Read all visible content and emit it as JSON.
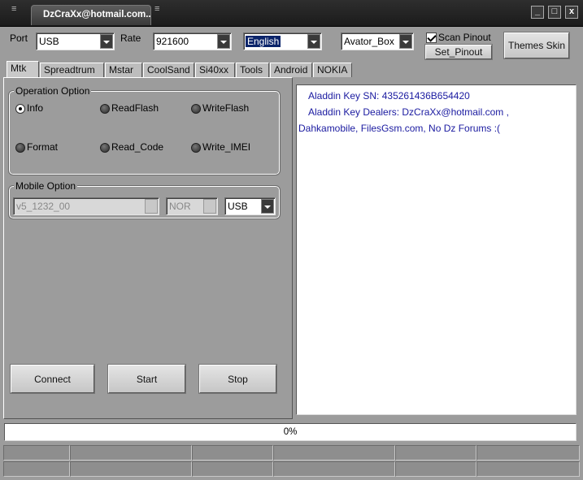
{
  "window": {
    "title": "DzCraXx@hotmail.com..",
    "minimize_label": "_",
    "maximize_label": "□",
    "close_label": "x"
  },
  "toolbar": {
    "port_label": "Port",
    "port_value": "USB",
    "rate_label": "Rate",
    "rate_value": "921600",
    "language_value": "English",
    "box_value": "Avator_Box",
    "scan_pinout_label": "Scan Pinout",
    "scan_pinout_checked": true,
    "set_pinout_label": "Set_Pinout",
    "themes_label": "Themes Skin"
  },
  "tabs": [
    "Mtk",
    "Spreadtrum",
    "Mstar",
    "CoolSand",
    "Si40xx",
    "Tools",
    "Android",
    "NOKIA"
  ],
  "operation": {
    "title": "Operation Option",
    "options": [
      "Info",
      "ReadFlash",
      "WriteFlash",
      "Format",
      "Read_Code",
      "Write_IMEI"
    ],
    "selected": "Info"
  },
  "mobile": {
    "title": "Mobile Option",
    "model_value": "v5_1232_00",
    "flash_value": "NOR",
    "conn_value": "USB"
  },
  "actions": {
    "connect_label": "Connect",
    "start_label": "Start",
    "stop_label": "Stop"
  },
  "log": {
    "line1": "Aladdin Key SN: 435261436B654420",
    "line2": "Aladdin Key Dealers: DzCraXx@hotmail.com ,",
    "line3": "Dahkamobile, FilesGsm.com, No Dz Forums :("
  },
  "progress": {
    "percent": 0,
    "label": "0%"
  },
  "colors": {
    "background": "#9c9c9c",
    "titlebar": "#1b1b1b",
    "log_text": "#1a1aa0",
    "selection": "#0a246a"
  }
}
